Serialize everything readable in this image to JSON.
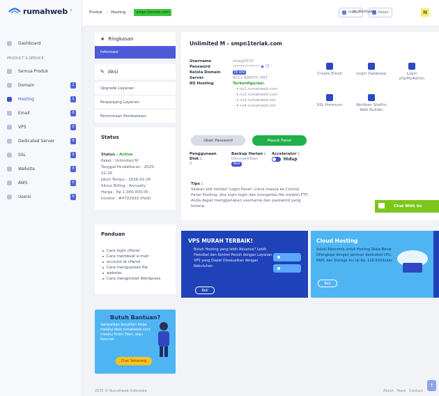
{
  "brand": {
    "name": "rumahweb"
  },
  "sidebar": {
    "dashboard": "Dashboard",
    "section": "PRODUCT & SERVICE",
    "items": [
      {
        "label": "Semua Produk",
        "badge": ""
      },
      {
        "label": "Domain",
        "badge": "1"
      },
      {
        "label": "Hosting",
        "badge": "1"
      },
      {
        "label": "Email",
        "badge": "0"
      },
      {
        "label": "VPS",
        "badge": "0"
      },
      {
        "label": "Dedicated Server",
        "badge": "0"
      },
      {
        "label": "SSL",
        "badge": "0"
      },
      {
        "label": "Website",
        "badge": "0"
      },
      {
        "label": "AWS",
        "badge": "0"
      },
      {
        "label": "Usersi",
        "badge": "0"
      }
    ]
  },
  "topbar": {
    "breadcrumb": [
      "Produk",
      "Hosting",
      "smpn1teriak.com"
    ],
    "promo": "Promo",
    "pesan": "Pesan",
    "user": "Hi, Novilyanti",
    "avatar": "N"
  },
  "ringkasan": {
    "title": "Ringkasan",
    "selected": "Informasi",
    "aksi_title": "Aksi",
    "aksi_items": [
      "Upgrade Layanan",
      "Perpanjang Layanan",
      "Permintaan Pembatalan"
    ]
  },
  "status": {
    "title": "Status",
    "status_label": "Status :",
    "status_value": "Active",
    "lines": [
      "Paket : Unlimited M",
      "Tanggal Pendaftaran : 2025-",
      "02-26",
      "Jatuh Tempo : 2026-02-26",
      "Siklus Billing : Annually",
      "Harga : Rp 1.000.000,00",
      "Invoice : #4702920 (Paid)"
    ]
  },
  "panduan": {
    "title": "Panduan",
    "items": [
      "Cara login cPanel",
      "Cara membuat e-mail",
      "account di cPanel",
      "Cara mengupload file",
      "website",
      "Cara menginstall Wordpress"
    ]
  },
  "help": {
    "title": "Butuh Bantuan?",
    "text": "Sampaikan kesulitan Anda melalui tiket.rumahweb.com melalui Kirim Tiket, atau livechat",
    "button": "Chat Sekarang"
  },
  "main": {
    "title": "Unlimited M - smpn1teriak.com",
    "info": {
      "username_label": "Username",
      "username_value": "smpg2515",
      "password_label": "Password",
      "password_value": "**************",
      "kelola_label": "Kelola Domain",
      "kelola_value": "Di sini",
      "server_label": "Server",
      "server_value": "ACCL BARITO XNT",
      "ns_label": "NS Hosting",
      "ns_value": "Terkonfigurasi.",
      "ns_list": [
        "ns1.rumahweb.com",
        "ns2.rumahweb.com",
        "ns3.rumahweb.net",
        "ns4.rumahweb.net"
      ]
    },
    "quick_links": [
      "Create Email",
      "Login Database",
      "Login phpMyAdmin",
      "SSL Premium",
      "Aktifkan SitePro Web Builder"
    ],
    "btn_ubah": "Ubah Password",
    "btn_masuk": "Masuk Panel",
    "penggunaan_label": "Penggunaan Disk :",
    "penggunaan_value": "0",
    "backup_label": "Backup Harian :",
    "backup_value": "Dinonaktifkan",
    "backup_btn": "Beli",
    "accel_label": "Accelerator :",
    "accel_value": "Hidup",
    "tips_label": "Tips :",
    "tips_text": "Silakan klik tombol 'Login Panel' untuk masuk ke Control Panel Hosting. Jika ingin login dan mengelola file melalui FTP, Anda dapat menggunakan username dan password yang tertera."
  },
  "chat": {
    "label": "Chat With Us"
  },
  "promo_vps": {
    "title": "VPS MURAH TERBAIK!",
    "text": "Butuh Hosting yang lebih Advance? Lebih Fleksibel dan Kontrol Penuh dengan Layanan VPS yang Dapat Disesuaikan dengan Kebutuhan",
    "button": "Beli"
  },
  "promo_cloud": {
    "title": "Cloud Hosting",
    "text": "Solusi Ekonomis untuk Hosting Skala Besar. Dilengkapi dengan jaminan dedicated CPU, RAM, dan Storage mu lai Rp. 120.000/bulan",
    "button": "Beli"
  },
  "footer": {
    "copyright": "2025 © Rumahweb Indonesia",
    "links": "About Team Contact"
  },
  "colors": {
    "accent": "#4d5ad8",
    "green": "#20b04b",
    "chat": "#7bc71b",
    "sky": "#4fb5f2",
    "navy": "#1f42b8"
  }
}
